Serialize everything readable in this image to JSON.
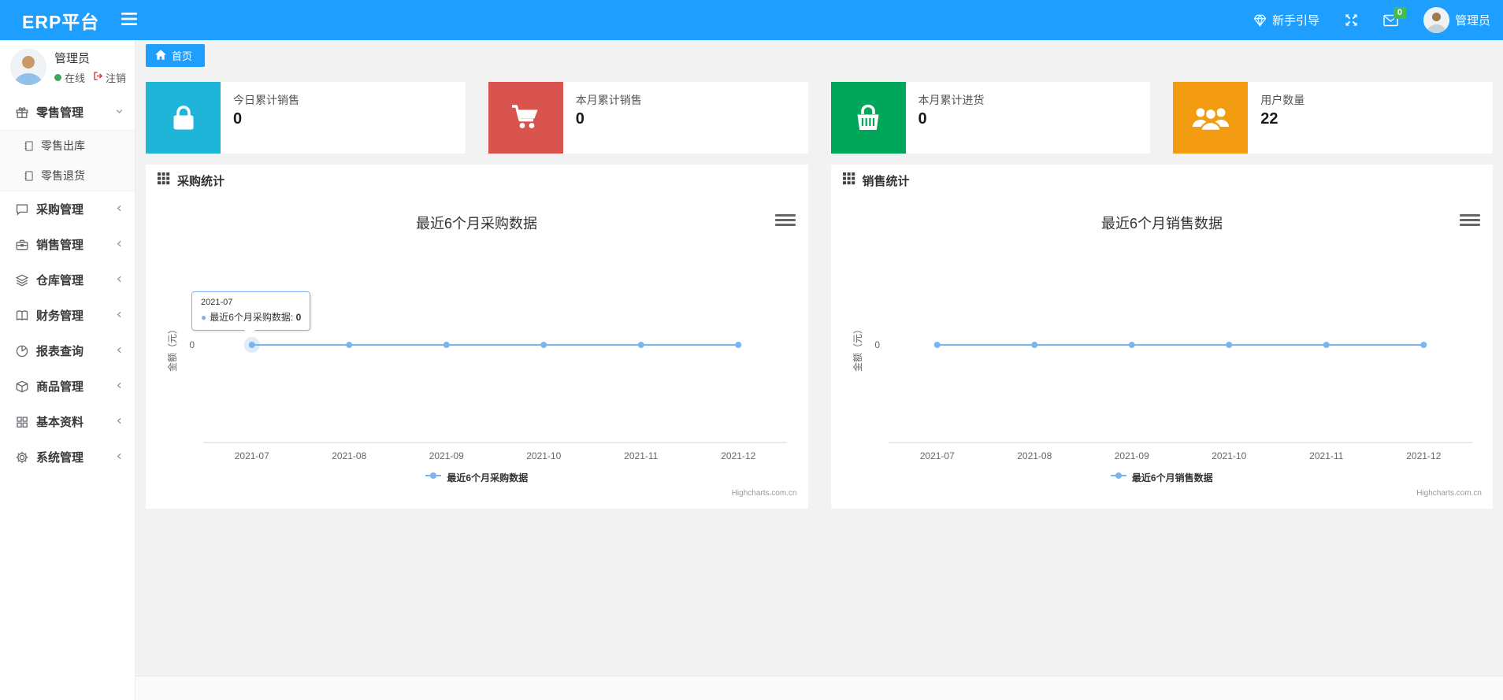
{
  "navbar": {
    "brand": "ERP平台",
    "guide_label": "新手引导",
    "message_badge": "0",
    "username": "管理员"
  },
  "sidebar": {
    "username": "管理员",
    "status_label": "在线",
    "logout_label": "注销",
    "menu": [
      {
        "id": "retail",
        "label": "零售管理",
        "icon": "gift-icon",
        "state": "expanded",
        "children": [
          {
            "id": "retail-outbound",
            "label": "零售出库",
            "icon": "journal-icon"
          },
          {
            "id": "retail-return",
            "label": "零售退货",
            "icon": "journal-icon"
          }
        ]
      },
      {
        "id": "purchase",
        "label": "采购管理",
        "icon": "chat-icon"
      },
      {
        "id": "sales",
        "label": "销售管理",
        "icon": "briefcase-icon"
      },
      {
        "id": "warehouse",
        "label": "仓库管理",
        "icon": "layers-icon"
      },
      {
        "id": "finance",
        "label": "财务管理",
        "icon": "book-icon"
      },
      {
        "id": "reports",
        "label": "报表查询",
        "icon": "pie-icon"
      },
      {
        "id": "goods",
        "label": "商品管理",
        "icon": "package-icon"
      },
      {
        "id": "basic",
        "label": "基本资料",
        "icon": "grid-icon"
      },
      {
        "id": "system",
        "label": "系统管理",
        "icon": "gear-icon"
      }
    ]
  },
  "breadcrumb": {
    "home_label": "首页",
    "home_icon": "home-icon"
  },
  "stat_cards": [
    {
      "id": "today-sales",
      "title": "今日累计销售",
      "value": "0",
      "color": "#1fb5d8",
      "icon": "bag-icon"
    },
    {
      "id": "month-sales",
      "title": "本月累计销售",
      "value": "0",
      "color": "#d9534f",
      "icon": "cart-icon"
    },
    {
      "id": "month-purchase",
      "title": "本月累计进货",
      "value": "0",
      "color": "#00a65a",
      "icon": "basket-icon"
    },
    {
      "id": "user-count",
      "title": "用户数量",
      "value": "22",
      "color": "#f39c12",
      "icon": "users-icon"
    }
  ],
  "chart_data": [
    {
      "id": "purchase",
      "type": "line",
      "panel_title": "采购统计",
      "title": "最近6个月采购数据",
      "categories": [
        "2021-07",
        "2021-08",
        "2021-09",
        "2021-10",
        "2021-11",
        "2021-12"
      ],
      "series": [
        {
          "name": "最近6个月采购数据",
          "values": [
            0,
            0,
            0,
            0,
            0,
            0
          ],
          "color": "#7cb5ec"
        }
      ],
      "ylabel": "金额（元）",
      "yticks": [
        "0"
      ],
      "ylim": [
        0,
        0
      ],
      "grid": false,
      "legend_position": "bottom",
      "credits": "Highcharts.com.cn",
      "hover_point_index": 0,
      "tooltip": {
        "visible": true,
        "x": "2021-07",
        "series": "最近6个月采购数据",
        "value": "0"
      }
    },
    {
      "id": "sales",
      "type": "line",
      "panel_title": "销售统计",
      "title": "最近6个月销售数据",
      "categories": [
        "2021-07",
        "2021-08",
        "2021-09",
        "2021-10",
        "2021-11",
        "2021-12"
      ],
      "series": [
        {
          "name": "最近6个月销售数据",
          "values": [
            0,
            0,
            0,
            0,
            0,
            0
          ],
          "color": "#7cb5ec"
        }
      ],
      "ylabel": "金额（元）",
      "yticks": [
        "0"
      ],
      "ylim": [
        0,
        0
      ],
      "grid": false,
      "legend_position": "bottom",
      "credits": "Highcharts.com.cn",
      "hover_point_index": null,
      "tooltip": {
        "visible": false
      }
    }
  ]
}
